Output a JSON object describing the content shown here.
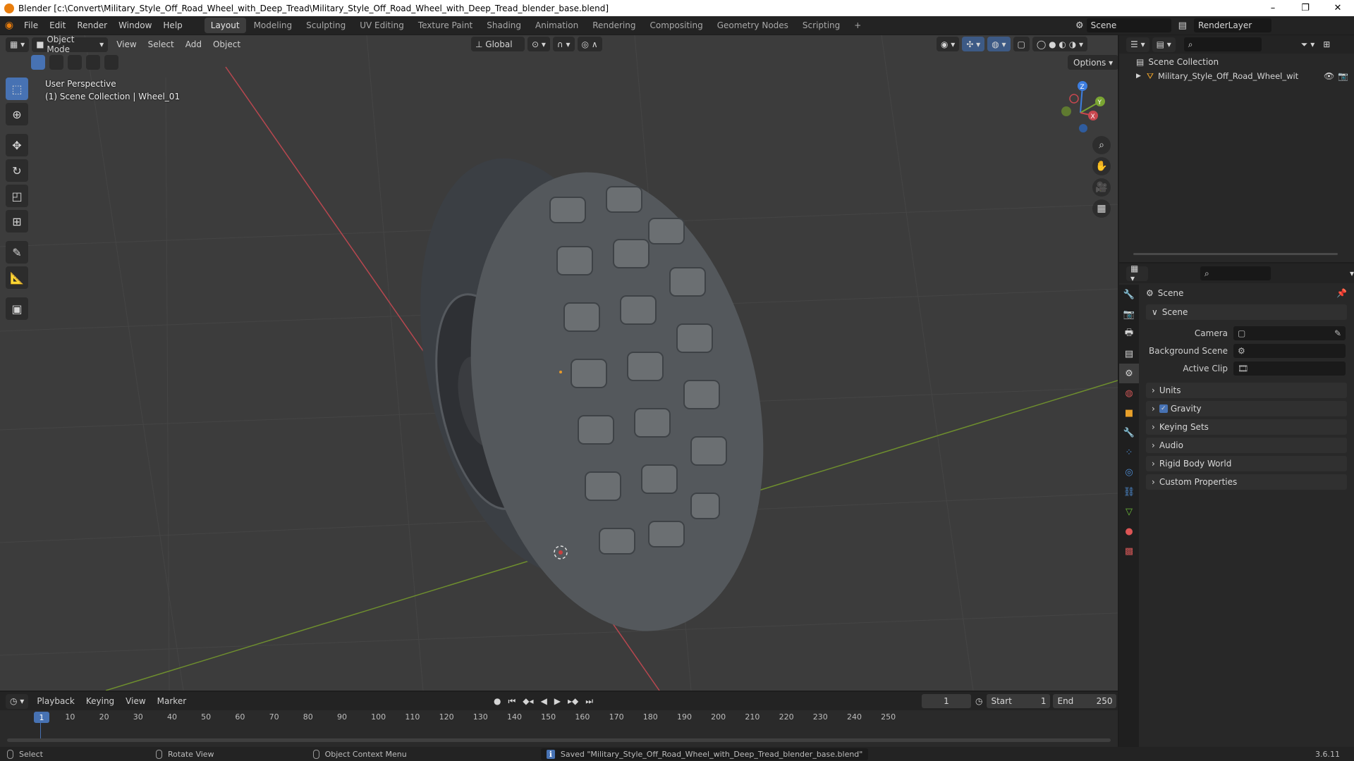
{
  "title": "Blender [c:\\Convert\\Military_Style_Off_Road_Wheel_with_Deep_Tread\\Military_Style_Off_Road_Wheel_with_Deep_Tread_blender_base.blend]",
  "window_controls": [
    "–",
    "❐",
    "✕"
  ],
  "menus": [
    "File",
    "Edit",
    "Render",
    "Window",
    "Help"
  ],
  "workspaces": [
    "Layout",
    "Modeling",
    "Sculpting",
    "UV Editing",
    "Texture Paint",
    "Shading",
    "Animation",
    "Rendering",
    "Compositing",
    "Geometry Nodes",
    "Scripting"
  ],
  "workspace_add": "+",
  "scene_name": "Scene",
  "render_layer": "RenderLayer",
  "viewport": {
    "mode": "Object Mode",
    "menu": [
      "View",
      "Select",
      "Add",
      "Object"
    ],
    "orientation": "Global",
    "options": "Options",
    "info_line1": "User Perspective",
    "info_line2": "(1) Scene Collection | Wheel_01",
    "gizmo": {
      "x": "X",
      "y": "Y",
      "z": "Z"
    },
    "colors": {
      "x_axis": "#c8474f",
      "y_axis": "#7aa532",
      "z_axis": "#3d7ee0",
      "selected": "#4772b3"
    }
  },
  "outliner": {
    "root": "Scene Collection",
    "item": "Military_Style_Off_Road_Wheel_with_De"
  },
  "properties": {
    "header": "Scene",
    "panel_title": "Scene",
    "fields": [
      {
        "label": "Camera",
        "value": ""
      },
      {
        "label": "Background Scene",
        "value": ""
      },
      {
        "label": "Active Clip",
        "value": ""
      }
    ],
    "collapsed_panels": [
      "Units",
      "Gravity",
      "Keying Sets",
      "Audio",
      "Rigid Body World",
      "Custom Properties"
    ]
  },
  "timeline": {
    "menu": [
      "Playback",
      "Keying",
      "View",
      "Marker"
    ],
    "current_frame": "1",
    "start_label": "Start",
    "start": "1",
    "end_label": "End",
    "end": "250",
    "ticks": [
      "1",
      "10",
      "20",
      "30",
      "40",
      "50",
      "60",
      "70",
      "80",
      "90",
      "100",
      "110",
      "120",
      "130",
      "140",
      "150",
      "160",
      "170",
      "180",
      "190",
      "200",
      "210",
      "220",
      "230",
      "240",
      "250"
    ]
  },
  "status": {
    "select": "Select",
    "rotate": "Rotate View",
    "context": "Object Context Menu",
    "message": "Saved \"Military_Style_Off_Road_Wheel_with_Deep_Tread_blender_base.blend\"",
    "version": "3.6.11"
  }
}
